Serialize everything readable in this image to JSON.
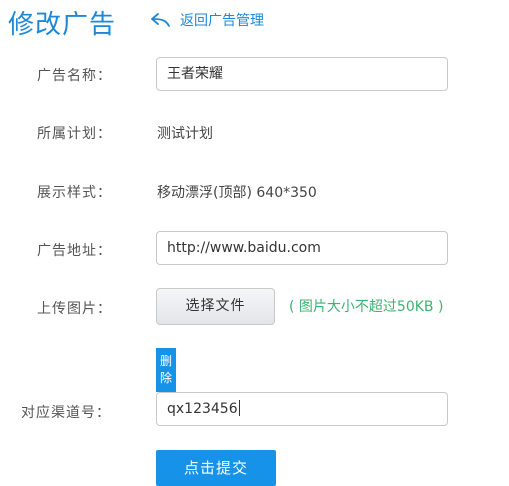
{
  "header": {
    "title": "修改广告",
    "back_label": "返回广告管理"
  },
  "form": {
    "name": {
      "label": "广告名称：",
      "value": "王者荣耀"
    },
    "plan": {
      "label": "所属计划：",
      "value": "测试计划"
    },
    "style": {
      "label": "展示样式：",
      "value": "移动漂浮(顶部) 640*350"
    },
    "url": {
      "label": "广告地址：",
      "value": "http://www.baidu.com"
    },
    "image": {
      "label": "上传图片：",
      "button_label": "选择文件",
      "hint": "( 图片大小不超过50KB )",
      "delete_char_1": "删",
      "delete_char_2": "除"
    },
    "channel": {
      "label": "对应渠道号：",
      "value": "qx123456"
    },
    "submit_label": "点击提交"
  },
  "colors": {
    "accent": "#1e88d6",
    "button_blue": "#1693e9",
    "hint_green": "#3cb371"
  }
}
